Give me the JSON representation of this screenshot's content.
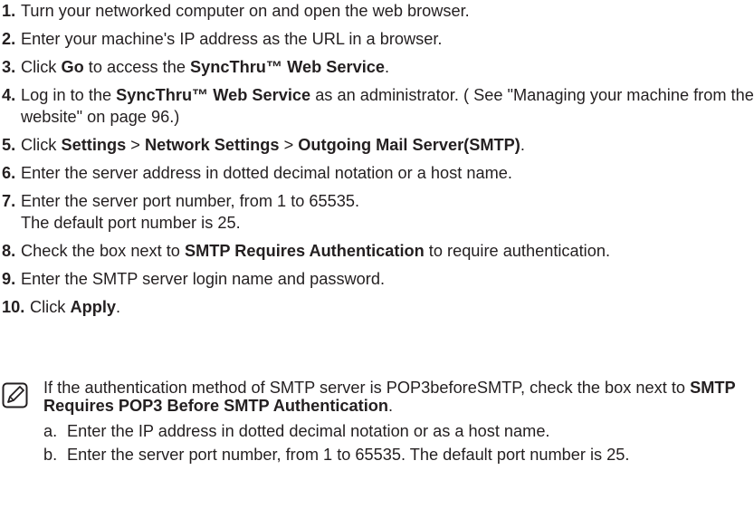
{
  "steps": [
    {
      "num": "1.",
      "parts": [
        {
          "t": "Turn your networked computer on and open the web browser."
        }
      ]
    },
    {
      "num": "2.",
      "parts": [
        {
          "t": "Enter your machine's IP address as the URL in a browser."
        }
      ]
    },
    {
      "num": "3.",
      "parts": [
        {
          "t": "Click "
        },
        {
          "t": "Go",
          "b": true
        },
        {
          "t": " to access the "
        },
        {
          "t": "SyncThru™ Web Service",
          "b": true
        },
        {
          "t": "."
        }
      ]
    },
    {
      "num": "4.",
      "parts": [
        {
          "t": "Log in to the "
        },
        {
          "t": "SyncThru™ Web Service",
          "b": true
        },
        {
          "t": " as an administrator. ( See \"Managing your machine from the website\" on page 96.)"
        }
      ]
    },
    {
      "num": "5.",
      "parts": [
        {
          "t": "Click "
        },
        {
          "t": "Settings",
          "b": true
        },
        {
          "t": " > "
        },
        {
          "t": "Network Settings",
          "b": true
        },
        {
          "t": " > "
        },
        {
          "t": "Outgoing Mail Server(SMTP)",
          "b": true
        },
        {
          "t": "."
        }
      ]
    },
    {
      "num": "6.",
      "parts": [
        {
          "t": "Enter the server address in dotted decimal notation or a host name."
        }
      ]
    },
    {
      "num": "7.",
      "parts": [
        {
          "t": "Enter the server port number, from 1 to 65535."
        },
        {
          "br": true
        },
        {
          "t": "The default port number is 25."
        }
      ]
    },
    {
      "num": "8.",
      "parts": [
        {
          "t": "Check the box next to "
        },
        {
          "t": "SMTP Requires Authentication",
          "b": true
        },
        {
          "t": " to require authentication."
        }
      ]
    },
    {
      "num": "9.",
      "parts": [
        {
          "t": "Enter the SMTP server login name and password."
        }
      ]
    },
    {
      "num": "10.",
      "parts": [
        {
          "t": "Click "
        },
        {
          "t": "Apply",
          "b": true
        },
        {
          "t": "."
        }
      ]
    }
  ],
  "note": {
    "icon": "note-pencil-icon",
    "parts": [
      {
        "t": "If the authentication method of SMTP server is POP3beforeSMTP, check the box next to "
      },
      {
        "t": "SMTP Requires POP3 Before SMTP Authentication",
        "b": true
      },
      {
        "t": "."
      }
    ],
    "substeps": [
      {
        "letter": "a.",
        "text": "Enter the IP address in dotted decimal notation or as a host name."
      },
      {
        "letter": "b.",
        "text": "Enter the server port number, from 1 to 65535. The default port number is 25."
      }
    ]
  }
}
